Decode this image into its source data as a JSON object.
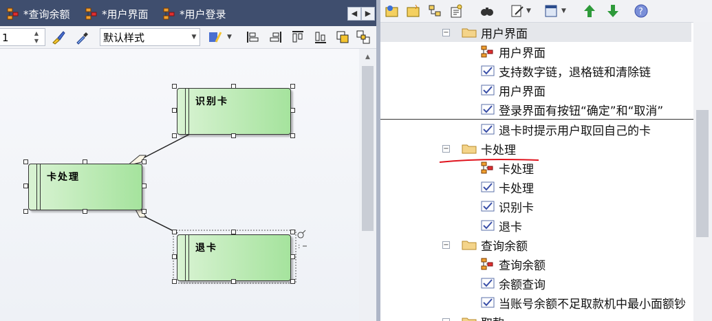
{
  "tabs": [
    {
      "label": "*查询余额"
    },
    {
      "label": "*用户界面"
    },
    {
      "label": "*用户登录"
    }
  ],
  "tab_nav": {
    "prev": "◀",
    "next": "▶"
  },
  "toolbar": {
    "line_width_value": "1",
    "style_select_value": "默认样式"
  },
  "diagram": {
    "classes": [
      {
        "name": "识别卡"
      },
      {
        "name": "卡处理"
      },
      {
        "name": "退卡"
      }
    ]
  },
  "tree": {
    "items": [
      {
        "label": "用户界面",
        "kind": "folder",
        "expanded": true,
        "highlighted": true
      },
      {
        "label": "用户界面",
        "kind": "diagram"
      },
      {
        "label": "支持数字链，退格链和清除链",
        "kind": "requirement"
      },
      {
        "label": "用户界面",
        "kind": "requirement"
      },
      {
        "label": "登录界面有按钮“确定”和“取消”",
        "kind": "requirement"
      },
      {
        "label": "退卡时提示用户取回自己的卡",
        "kind": "requirement"
      },
      {
        "label": "卡处理",
        "kind": "folder",
        "expanded": true,
        "annotated": true
      },
      {
        "label": "卡处理",
        "kind": "diagram"
      },
      {
        "label": "卡处理",
        "kind": "requirement"
      },
      {
        "label": "识别卡",
        "kind": "requirement"
      },
      {
        "label": "退卡",
        "kind": "requirement"
      },
      {
        "label": "查询余额",
        "kind": "folder",
        "expanded": true
      },
      {
        "label": "查询余额",
        "kind": "diagram"
      },
      {
        "label": "余额查询",
        "kind": "requirement"
      },
      {
        "label": "当账号余额不足取款机中最小面额钞",
        "kind": "requirement"
      },
      {
        "label": "取款",
        "kind": "folder",
        "expanded": true
      }
    ]
  },
  "colors": {
    "tab_bar": "#3f4e6e",
    "class_fill_start": "#d9f3d3",
    "class_fill_end": "#a5e39d",
    "annotation_red": "#e0141e",
    "arrow_green": "#2e9a3a"
  },
  "icons": [
    "diagram-icon",
    "brush-icon",
    "eyedropper-icon",
    "font-icon",
    "align-left-icon",
    "align-right-icon",
    "align-top-icon",
    "align-bottom-icon",
    "same-size-icon",
    "group-icon",
    "folder-add-icon",
    "package-icon",
    "diagram-add-icon",
    "element-add-icon",
    "binoculars-icon",
    "edit-icon",
    "window-icon",
    "arrow-up-icon",
    "arrow-down-icon",
    "help-icon",
    "folder-icon",
    "requirement-icon"
  ]
}
